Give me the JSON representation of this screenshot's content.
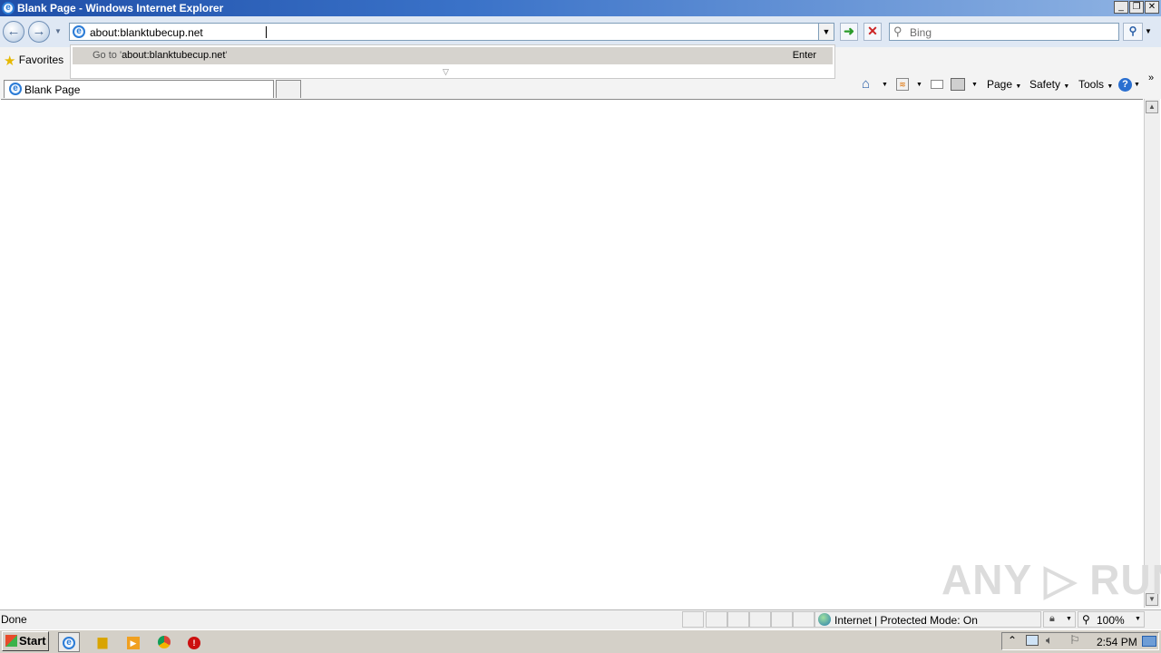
{
  "window": {
    "title": "Blank Page - Windows Internet Explorer",
    "minimize": "_",
    "restore": "❐",
    "close": "✕"
  },
  "nav": {
    "address": "about:blanktubecup.net",
    "search_placeholder": "Bing"
  },
  "autocomplete": {
    "goto_prefix": "Go to '",
    "goto_value": "about:blanktubecup.net",
    "goto_suffix": "'",
    "enter": "Enter"
  },
  "favorites": {
    "label": "Favorites"
  },
  "tab": {
    "label": "Blank Page"
  },
  "commands": {
    "page": "Page",
    "safety": "Safety",
    "tools": "Tools",
    "help": "?"
  },
  "watermark": "ANY ▷ RUN",
  "status": {
    "text": "Done",
    "zone": "Internet | Protected Mode: On",
    "zoom": "100%"
  },
  "taskbar": {
    "start": "Start",
    "clock": "2:54 PM"
  },
  "icons": {
    "back": "back-icon",
    "forward": "forward-icon",
    "refresh": "refresh-icon",
    "stop": "stop-icon",
    "search": "search-icon",
    "home": "home-icon",
    "feeds": "feeds-icon",
    "mail": "mail-icon",
    "print": "print-icon"
  }
}
